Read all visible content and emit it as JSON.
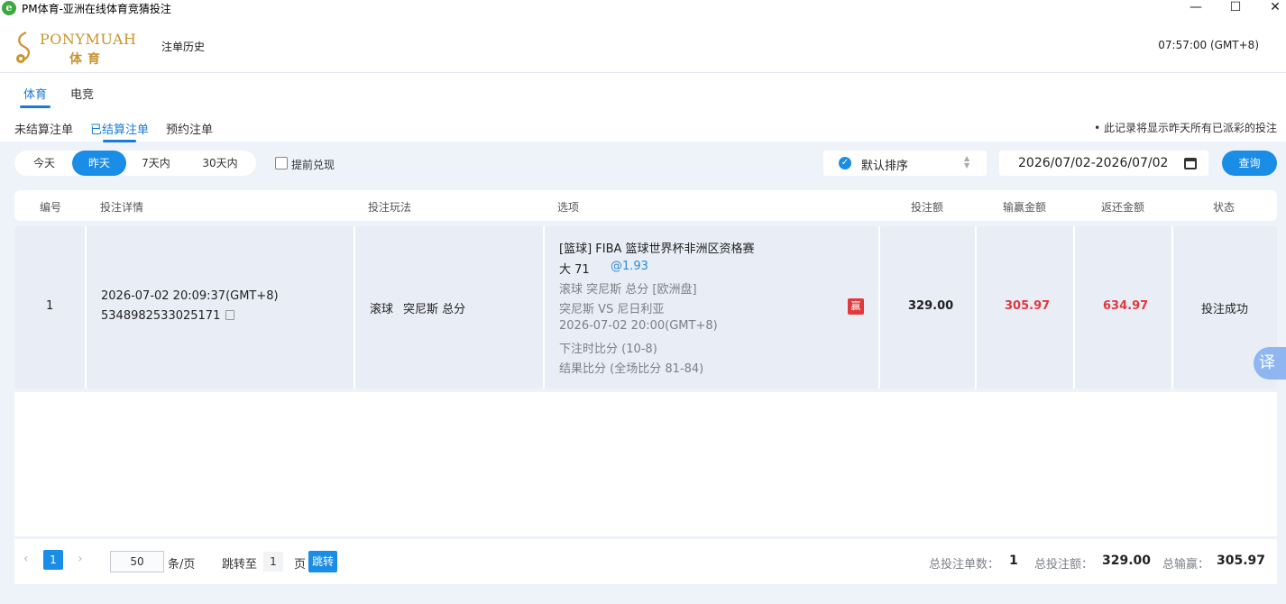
{
  "window": {
    "title": "PM体育-亚洲在线体育竞猜投注",
    "icon": "ie-browser-icon",
    "min": "—",
    "max": "☐",
    "close": "✕"
  },
  "header": {
    "brand": "PONYMUAH",
    "brand_sub": "体育",
    "nav_history": "注单历史",
    "clock": "07:57:00 (GMT+8)",
    "brand_color": "#c9932e"
  },
  "category_tabs": [
    {
      "label": "体育",
      "active": true
    },
    {
      "label": "电竞",
      "active": false
    }
  ],
  "sub_tabs": [
    {
      "label": "未结算注单",
      "active": false
    },
    {
      "label": "已结算注单",
      "active": true
    },
    {
      "label": "预约注单",
      "active": false
    }
  ],
  "notice": "• 此记录将显示昨天所有已派彩的投注",
  "filters": {
    "ranges": [
      {
        "label": "今天",
        "active": false
      },
      {
        "label": "昨天",
        "active": true
      },
      {
        "label": "7天内",
        "active": false
      },
      {
        "label": "30天内",
        "active": false
      }
    ],
    "early_cashout_label": "提前兑现",
    "early_cashout_checked": false,
    "sort_label": "默认排序",
    "date_range": "2026/07/02-2026/07/02",
    "query_label": "查询"
  },
  "table": {
    "columns": [
      "编号",
      "投注详情",
      "投注玩法",
      "选项",
      "投注额",
      "输赢金额",
      "返还金额",
      "状态"
    ],
    "rows": [
      {
        "index": "1",
        "bet_time": "2026-07-02 20:09:37(GMT+8)",
        "bet_id": "5348982533025171",
        "play_type": "滚球",
        "play_market": "突尼斯 总分",
        "league": "[篮球] FIBA 篮球世界杯非洲区资格赛",
        "selection": "大 71",
        "odds": "@1.93",
        "market_detail": "滚球 突尼斯 总分 [欧洲盘]",
        "match": "突尼斯 VS 尼日利亚",
        "match_time": "2026-07-02 20:00(GMT+8)",
        "score_at_bet": "下注时比分 (10-8)",
        "final_score": "结果比分 (全场比分 81-84)",
        "result_badge": "赢",
        "stake": "329.00",
        "win_loss": "305.97",
        "returned": "634.97",
        "status": "投注成功"
      }
    ]
  },
  "pagination": {
    "prev": "‹",
    "next": "›",
    "current_page": "1",
    "page_size": "50",
    "page_size_unit": "条/页",
    "jump_label": "跳转至",
    "jump_value": "1",
    "page_unit": "页",
    "go_label": "跳转"
  },
  "summary": {
    "count_label": "总投注单数：",
    "count_value": "1",
    "stake_label": "总投注额：",
    "stake_value": "329.00",
    "winloss_label": "总输赢：",
    "winloss_value": "305.97"
  },
  "translate_button": "译",
  "accent_color": "#1a8de6",
  "win_color": "#e0393e"
}
